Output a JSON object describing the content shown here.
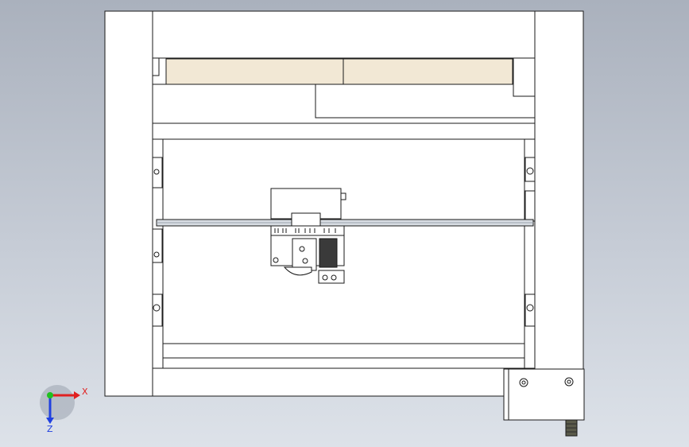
{
  "viewport": {
    "background_top": "#aab1bd",
    "background_bottom": "#dde2e9"
  },
  "model": {
    "frame_color": "#ffffff",
    "edge_color": "#1a1a1a",
    "panel_color": "#f2e8d5",
    "motor_color": "#3a3a3a",
    "rail_color": "#d8dde3",
    "connector_color": "#5a5a4a"
  },
  "triad": {
    "x_label": "X",
    "z_label": "Z",
    "x_color": "#e02020",
    "y_color": "#20c020",
    "z_color": "#2040e0"
  }
}
